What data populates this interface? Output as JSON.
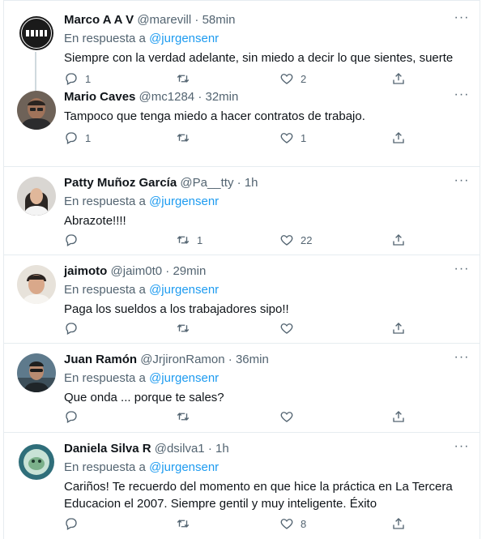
{
  "colors": {
    "accent": "#1d9bf0",
    "muted": "#536471",
    "text": "#0f1419",
    "border": "#e6ecf0"
  },
  "icons": {
    "reply": "reply-icon",
    "retweet": "retweet-icon",
    "like": "heart-icon",
    "share": "share-icon",
    "more": "more-icon"
  },
  "tweets": [
    {
      "name": "Marco A A V",
      "handle": "@marevill",
      "time": "58min",
      "reply_prefix": "En respuesta a",
      "reply_handle": "@jurgensenr",
      "text": "Siempre con la verdad adelante, sin miedo a decir lo que sientes, suerte",
      "replies": "1",
      "retweets": "",
      "likes": "2"
    },
    {
      "name": "Mario Caves",
      "handle": "@mc1284",
      "time": "32min",
      "reply_prefix": "",
      "reply_handle": "",
      "text": "Tampoco que tenga miedo a hacer contratos de trabajo.",
      "replies": "1",
      "retweets": "",
      "likes": "1"
    },
    {
      "name": "Patty Muñoz García",
      "handle": "@Pa__tty",
      "time": "1h",
      "reply_prefix": "En respuesta a",
      "reply_handle": "@jurgensenr",
      "text": "Abrazote!!!!",
      "replies": "",
      "retweets": "1",
      "likes": "22"
    },
    {
      "name": "jaimoto",
      "handle": "@jaim0t0",
      "time": "29min",
      "reply_prefix": "En respuesta a",
      "reply_handle": "@jurgensenr",
      "text": "Paga los sueldos a los trabajadores sipo!!",
      "replies": "",
      "retweets": "",
      "likes": ""
    },
    {
      "name": "Juan Ramón",
      "handle": "@JrjironRamon",
      "time": "36min",
      "reply_prefix": "En respuesta a",
      "reply_handle": "@jurgensenr",
      "text": "Que onda ... porque te sales?",
      "replies": "",
      "retweets": "",
      "likes": ""
    },
    {
      "name": "Daniela Silva R",
      "handle": "@dsilva1",
      "time": "1h",
      "reply_prefix": "En respuesta a",
      "reply_handle": "@jurgensenr",
      "text": "Cariños! Te recuerdo del momento en que hice la práctica en La Tercera Educacion el 2007. Siempre gentil y muy inteligente. Éxito",
      "replies": "",
      "retweets": "",
      "likes": "8"
    }
  ]
}
